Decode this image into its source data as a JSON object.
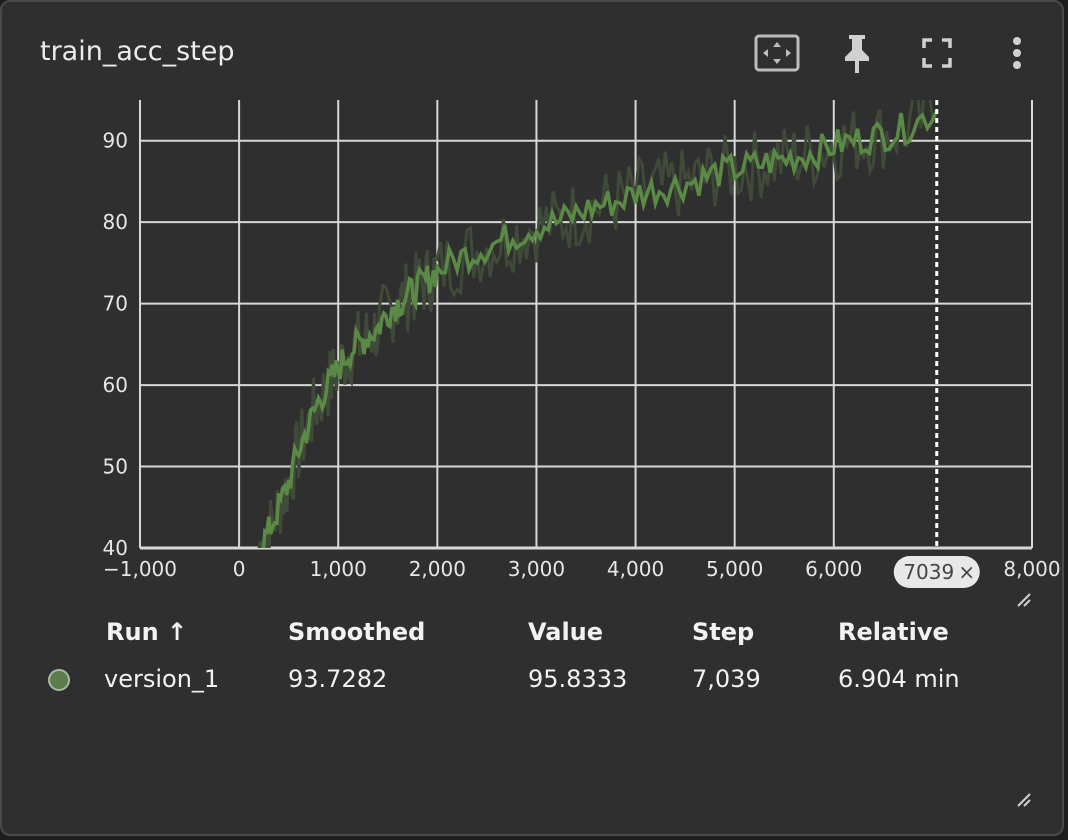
{
  "card": {
    "title": "train_acc_step"
  },
  "toolbar": {
    "icons": [
      "fit-domain-icon",
      "pin-icon",
      "fullscreen-icon",
      "more-vert-icon"
    ]
  },
  "colors": {
    "background": "#2f2f2f",
    "grid": "#d8d8d8",
    "series": "#5a8a45",
    "raw_series": "#3f4a38",
    "run_dot": "#5b7c4c"
  },
  "chart_data": {
    "type": "line",
    "title": "",
    "xlabel": "",
    "ylabel": "",
    "xlim": [
      -1000,
      8000
    ],
    "ylim": [
      40,
      95
    ],
    "x_ticks": [
      "−1,000",
      "0",
      "1,000",
      "2,000",
      "3,000",
      "4,000",
      "5,000",
      "6,000",
      "8,000"
    ],
    "x_tick_values": [
      -1000,
      0,
      1000,
      2000,
      3000,
      4000,
      5000,
      6000,
      8000
    ],
    "y_ticks": [
      "40",
      "50",
      "60",
      "70",
      "80",
      "90"
    ],
    "y_tick_values": [
      40,
      50,
      60,
      70,
      80,
      90
    ],
    "grid": true,
    "cursor_step": 7039,
    "cursor_label": "7039",
    "series": [
      {
        "name": "version_1",
        "x": [
          200,
          300,
          400,
          500,
          600,
          700,
          800,
          900,
          1000,
          1100,
          1200,
          1300,
          1400,
          1500,
          1600,
          1700,
          1800,
          1900,
          2000,
          2200,
          2400,
          2600,
          2800,
          3000,
          3200,
          3400,
          3600,
          3800,
          4000,
          4200,
          4400,
          4600,
          4800,
          5000,
          5200,
          5400,
          5600,
          5800,
          6000,
          6200,
          6400,
          6600,
          6800,
          7039
        ],
        "smoothed": [
          40,
          42,
          45,
          48,
          52,
          55,
          58,
          60,
          62,
          64,
          65,
          66,
          67,
          69,
          70,
          71,
          72,
          73,
          74,
          75.5,
          76.5,
          77.5,
          78.5,
          79.5,
          80,
          81,
          82,
          82.5,
          83.5,
          84,
          84.5,
          85,
          86,
          86.5,
          87,
          87.5,
          88,
          88.5,
          89.5,
          90,
          90.5,
          91,
          92,
          93.7282
        ]
      }
    ]
  },
  "runs_table": {
    "headers": {
      "run": "Run ↑",
      "smoothed": "Smoothed",
      "value": "Value",
      "step": "Step",
      "relative": "Relative"
    },
    "rows": [
      {
        "run": "version_1",
        "smoothed": "93.7282",
        "value": "95.8333",
        "step": "7,039",
        "relative": "6.904 min"
      }
    ]
  }
}
